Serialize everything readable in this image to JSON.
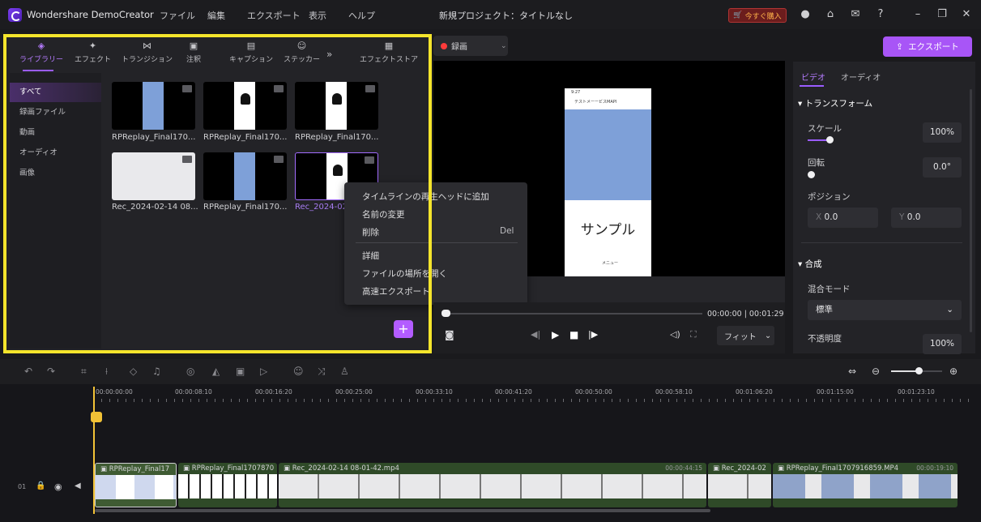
{
  "app": {
    "name": "Wondershare DemoCreator",
    "project_title": "新規プロジェクト：タイトルなし",
    "buy_label": "今すぐ購入"
  },
  "menu": [
    "ファイル",
    "編集",
    "エクスポート",
    "表示",
    "ヘルプ"
  ],
  "library_tabs": [
    "ライブラリー",
    "エフェクト",
    "トランジション",
    "注釈",
    "キャプション",
    "ステッカー",
    "エフェクトストア"
  ],
  "sidebar": [
    "すべて",
    "録画ファイル",
    "動画",
    "オーディオ",
    "画像"
  ],
  "media": [
    {
      "label": "RPReplay_Final170..."
    },
    {
      "label": "RPReplay_Final170..."
    },
    {
      "label": "RPReplay_Final170..."
    },
    {
      "label": "Rec_2024-02-14 08..."
    },
    {
      "label": "RPReplay_Final170..."
    },
    {
      "label": "Rec_2024-02"
    }
  ],
  "context_menu": {
    "add_to_playhead": "タイムラインの再生ヘッドに追加",
    "rename": "名前の変更",
    "delete": "削除",
    "delete_shortcut": "Del",
    "details": "詳細",
    "open_location": "ファイルの場所を開く",
    "fast_export": "高速エクスポート"
  },
  "record": {
    "label": "録画"
  },
  "export_label": "エクスポート",
  "preview": {
    "phone_text": "サンプル",
    "phone_menu": "メニュー",
    "phone_header": "テストメーービスMAPI",
    "phone_time": "9:27"
  },
  "playback": {
    "current": "00:00:00",
    "total": "00:01:29",
    "fit": "フィット"
  },
  "right_panel": {
    "tabs": [
      "ビデオ",
      "オーディオ"
    ],
    "transform": "トランスフォーム",
    "scale_label": "スケール",
    "scale_value": "100%",
    "rotate_label": "回転",
    "rotate_value": "0.0°",
    "position_label": "ポジション",
    "x_prefix": "X",
    "x_value": "0.0",
    "y_prefix": "Y",
    "y_value": "0.0",
    "composite": "合成",
    "blend_label": "混合モード",
    "blend_value": "標準",
    "opacity_label": "不透明度",
    "opacity_value": "100%"
  },
  "ruler": [
    "00:00:00:00",
    "00:00:08:10",
    "00:00:16:20",
    "00:00:25:00",
    "00:00:33:10",
    "00:00:41:20",
    "00:00:50:00",
    "00:00:58:10",
    "00:01:06:20",
    "00:01:15:00",
    "00:01:23:10"
  ],
  "track": {
    "number": "01"
  },
  "clips": [
    {
      "name": "RPReplay_Final17",
      "duration": ""
    },
    {
      "name": "RPReplay_Final1707870",
      "duration": ""
    },
    {
      "name": "Rec_2024-02-14 08-01-42.mp4",
      "duration": "00:00:44:15"
    },
    {
      "name": "Rec_2024-02",
      "duration": ""
    },
    {
      "name": "RPReplay_Final1707916859.MP4",
      "duration": "00:00:19:10"
    }
  ]
}
